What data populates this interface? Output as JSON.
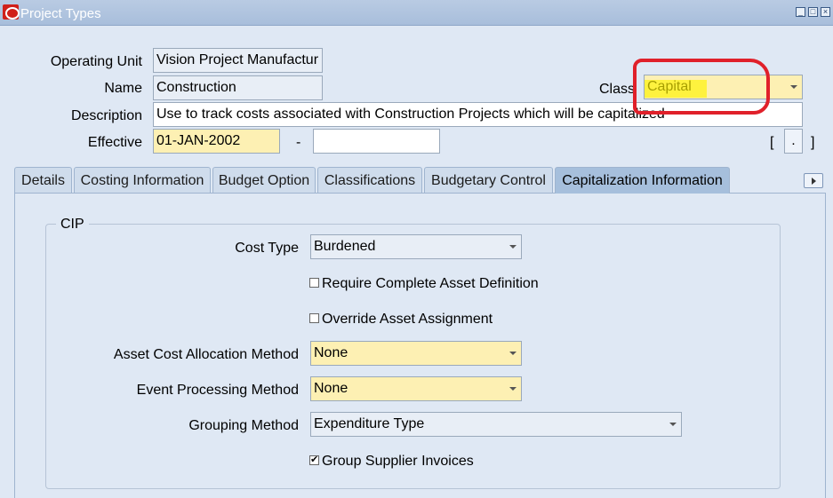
{
  "window": {
    "title": "Project Types"
  },
  "form": {
    "operating_unit": {
      "label": "Operating Unit",
      "value": "Vision Project Manufactur"
    },
    "name": {
      "label": "Name",
      "value": "Construction"
    },
    "class": {
      "label": "Class",
      "value": "Capital"
    },
    "description": {
      "label": "Description",
      "value": "Use to track costs associated with Construction Projects which will be capitalized"
    },
    "effective": {
      "label": "Effective",
      "from": "01-JAN-2002",
      "separator": "-",
      "to": ""
    },
    "flex": {
      "open": "[",
      "dot": ".",
      "close": "]"
    }
  },
  "tabs": [
    {
      "label": "Details",
      "active": false
    },
    {
      "label": "Costing Information",
      "active": false
    },
    {
      "label": "Budget Option",
      "active": false
    },
    {
      "label": "Classifications",
      "active": false
    },
    {
      "label": "Budgetary Control",
      "active": false
    },
    {
      "label": "Capitalization Information",
      "active": true
    }
  ],
  "cip": {
    "title": "CIP",
    "cost_type": {
      "label": "Cost Type",
      "value": "Burdened"
    },
    "require_complete_asset_definition": {
      "label": "Require Complete Asset Definition",
      "checked": false
    },
    "override_asset_assignment": {
      "label": "Override Asset Assignment",
      "checked": false
    },
    "asset_cost_allocation_method": {
      "label": "Asset Cost Allocation Method",
      "value": "None"
    },
    "event_processing_method": {
      "label": "Event Processing Method",
      "value": "None"
    },
    "grouping_method": {
      "label": "Grouping Method",
      "value": "Expenditure Type"
    },
    "group_supplier_invoices": {
      "label": "Group Supplier Invoices",
      "checked": true,
      "mark": "✔"
    }
  },
  "colors": {
    "required_field": "#fdf0b3",
    "annotation": "#e0202a",
    "highlight": "#fff300"
  }
}
